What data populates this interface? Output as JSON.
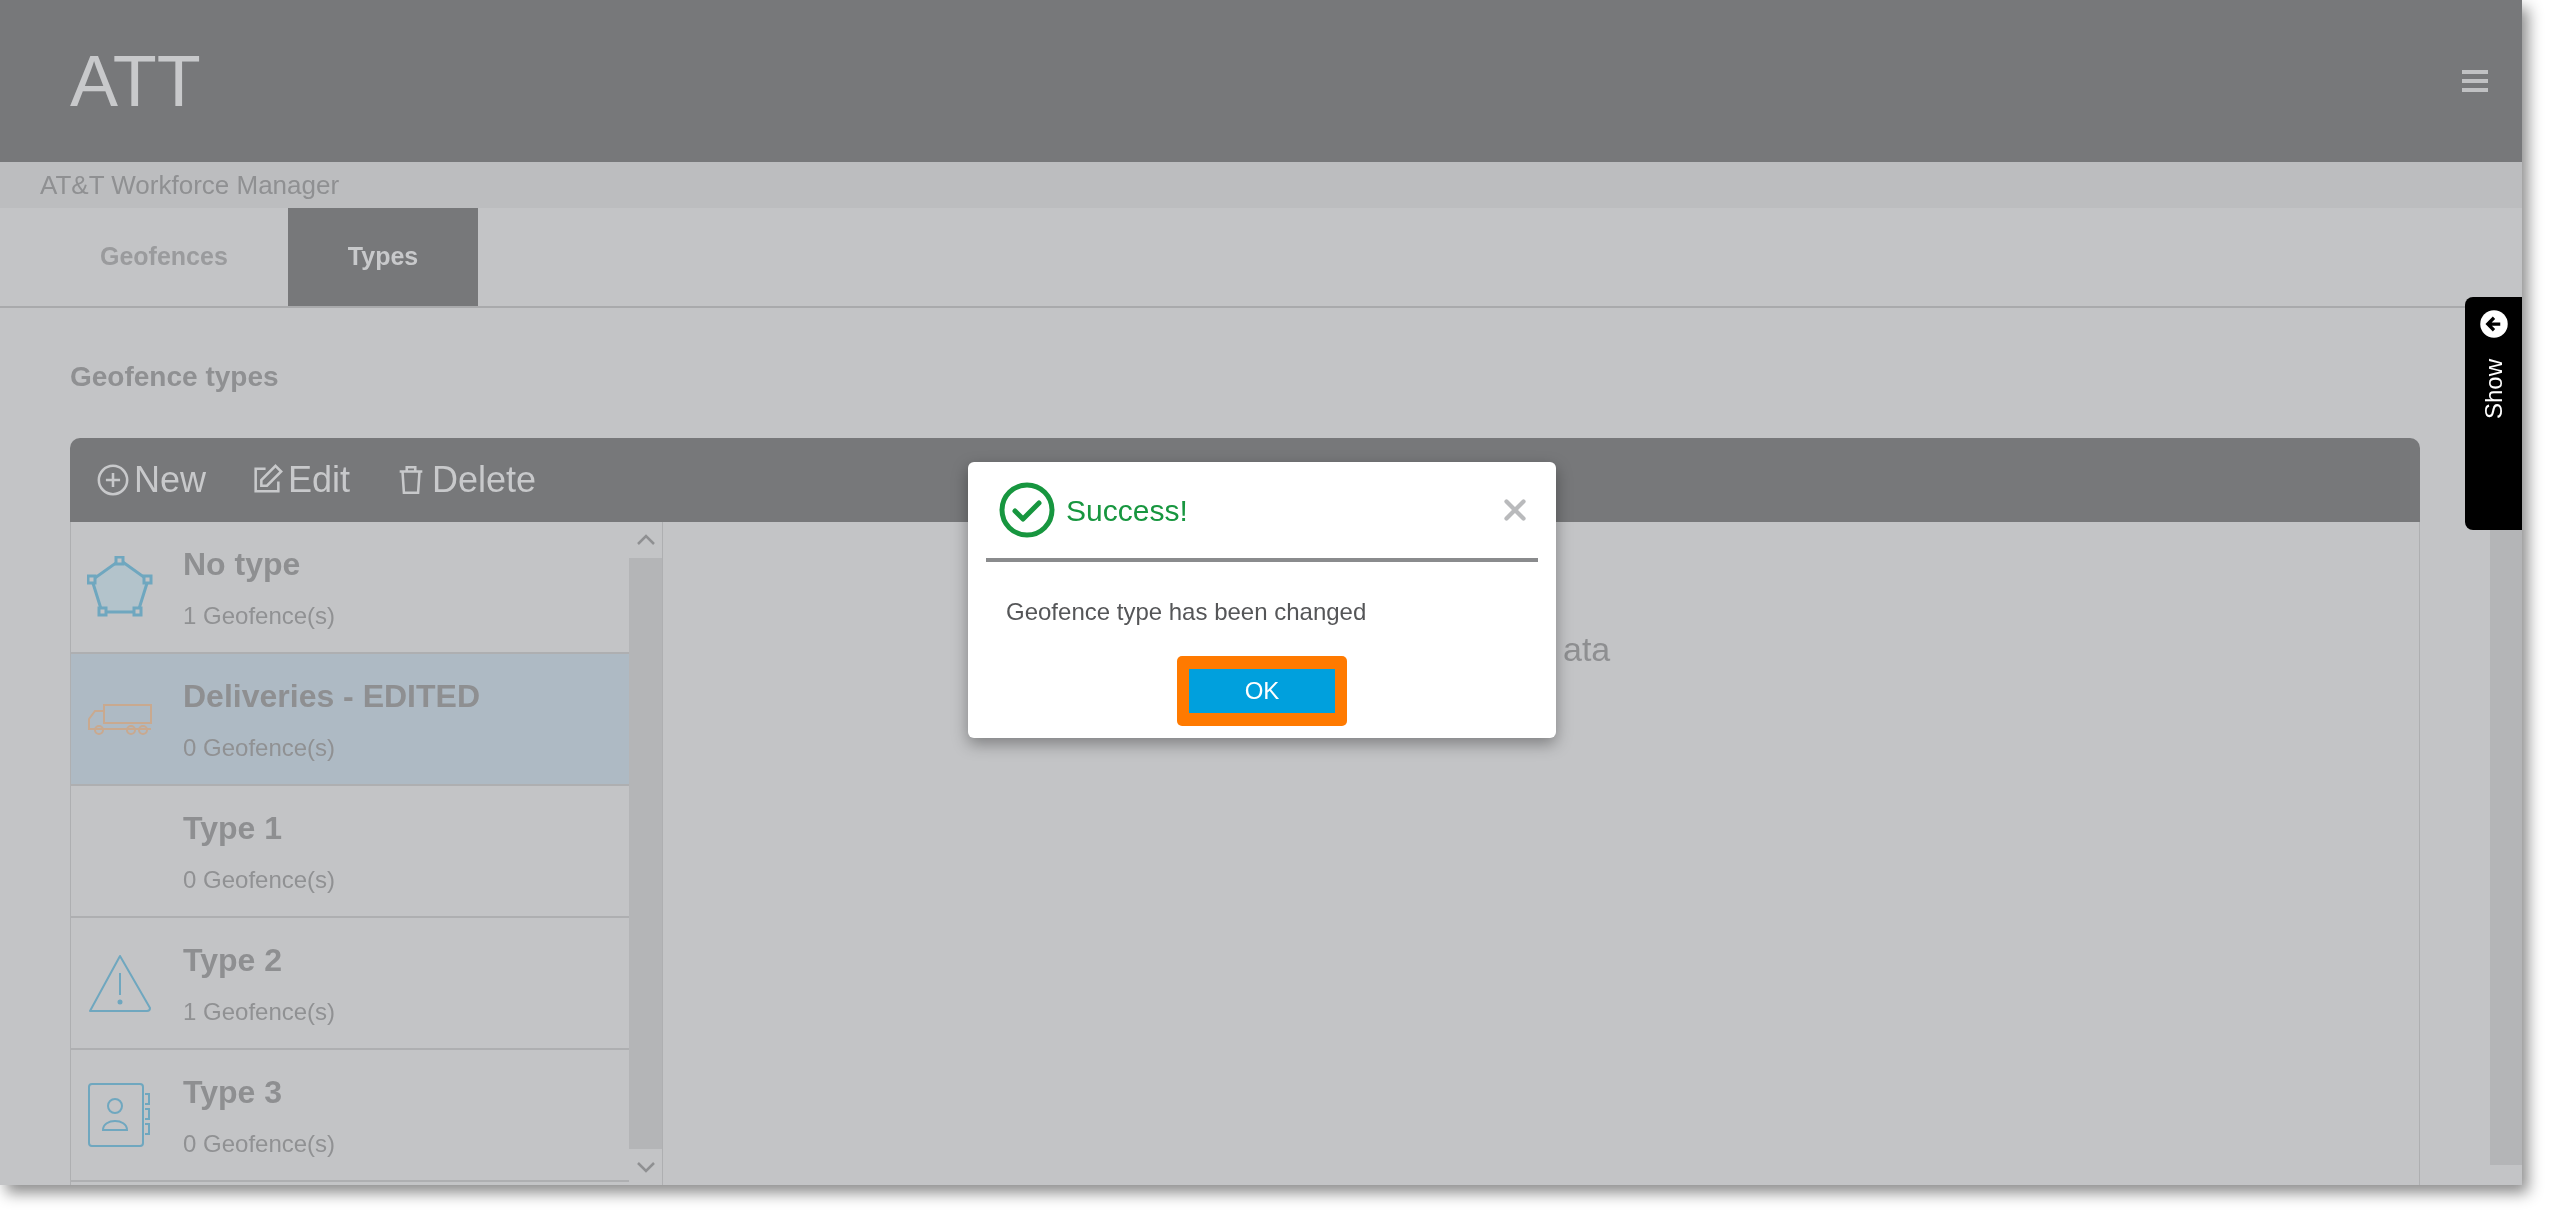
{
  "header": {
    "logo": "ATT",
    "subtitle": "AT&T Workforce Manager"
  },
  "tabs": [
    {
      "label": "Geofences",
      "selected": false
    },
    {
      "label": "Types",
      "selected": true
    }
  ],
  "section_title": "Geofence types",
  "toolbar": [
    {
      "label": "New",
      "kind": "new"
    },
    {
      "label": "Edit",
      "kind": "edit"
    },
    {
      "label": "Delete",
      "kind": "delete"
    }
  ],
  "types": [
    {
      "name": "No type",
      "count": "1 Geofence(s)",
      "selected": false
    },
    {
      "name": "Deliveries - EDITED",
      "count": "0 Geofence(s)",
      "selected": true
    },
    {
      "name": "Type 1",
      "count": "0 Geofence(s)",
      "selected": false
    },
    {
      "name": "Type 2",
      "count": "1 Geofence(s)",
      "selected": false
    },
    {
      "name": "Type 3",
      "count": "0 Geofence(s)",
      "selected": false
    }
  ],
  "detail_text": "ata",
  "side_tab": {
    "label": "Show"
  },
  "dialog": {
    "title": "Success!",
    "message": "Geofence type has been changed",
    "button": {
      "label": "OK",
      "highlighted": true
    }
  }
}
